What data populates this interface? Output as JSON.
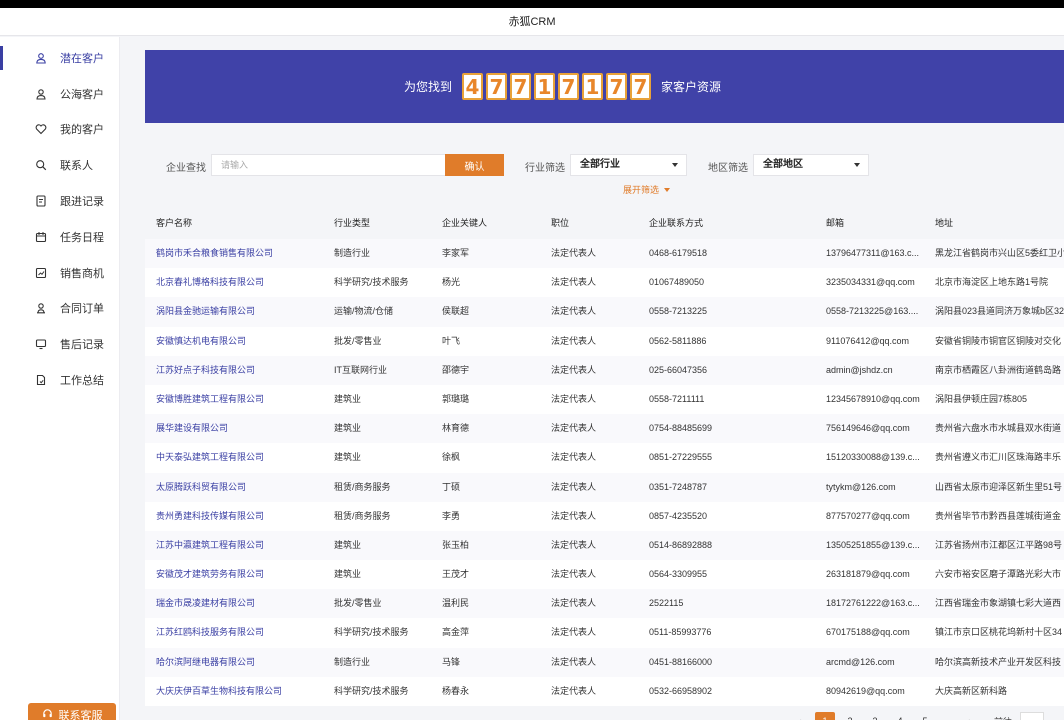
{
  "window": {
    "title": "赤狐CRM"
  },
  "sidebar": {
    "items": [
      {
        "label": "潜在客户",
        "icon": "user-icon"
      },
      {
        "label": "公海客户",
        "icon": "users-icon"
      },
      {
        "label": "我的客户",
        "icon": "heart-icon"
      },
      {
        "label": "联系人",
        "icon": "search-user-icon"
      },
      {
        "label": "跟进记录",
        "icon": "document-icon"
      },
      {
        "label": "任务日程",
        "icon": "calendar-icon"
      },
      {
        "label": "销售商机",
        "icon": "chart-icon"
      },
      {
        "label": "合同订单",
        "icon": "contract-icon"
      },
      {
        "label": "售后记录",
        "icon": "monitor-icon"
      },
      {
        "label": "工作总结",
        "icon": "summary-icon"
      }
    ],
    "service_label": "联系客服"
  },
  "banner": {
    "prefix": "为您找到",
    "digits": [
      "4",
      "7",
      "7",
      "1",
      "7",
      "1",
      "7",
      "7"
    ],
    "suffix": "家客户资源"
  },
  "filters": {
    "search_label": "企业查找",
    "search_placeholder": "请输入",
    "confirm_label": "确认",
    "industry_label": "行业筛选",
    "industry_value": "全部行业",
    "region_label": "地区筛选",
    "region_value": "全部地区",
    "expand_label": "展开筛选"
  },
  "table": {
    "columns": [
      "客户名称",
      "行业类型",
      "企业关键人",
      "职位",
      "企业联系方式",
      "邮箱",
      "地址"
    ],
    "rows": [
      [
        "鹤岗市禾合粮食销售有限公司",
        "制造行业",
        "李家军",
        "法定代表人",
        "0468-6179518",
        "13796477311@163.c...",
        "黑龙江省鹤岗市兴山区5委红卫小"
      ],
      [
        "北京春礼博格科技有限公司",
        "科学研究/技术服务",
        "杨光",
        "法定代表人",
        "01067489050",
        "3235034331@qq.com",
        "北京市海淀区上地东路1号院"
      ],
      [
        "涡阳县金驰运输有限公司",
        "运输/物流/仓储",
        "侯联超",
        "法定代表人",
        "0558-7213225",
        "0558-7213225@163....",
        "涡阳县023县道同济万象城b区32"
      ],
      [
        "安徽慎达机电有限公司",
        "批发/零售业",
        "叶飞",
        "法定代表人",
        "0562-5811886",
        "911076412@qq.com",
        "安徽省铜陵市铜官区铜陵对交化"
      ],
      [
        "江苏好点子科技有限公司",
        "IT互联网行业",
        "邵德宇",
        "法定代表人",
        "025-66047356",
        "admin@jshdz.cn",
        "南京市栖霞区八卦洲街道鹤岛路"
      ],
      [
        "安徽博胜建筑工程有限公司",
        "建筑业",
        "郭璐璐",
        "法定代表人",
        "0558-7211111",
        "12345678910@qq.com",
        "涡阳县伊顿庄园7栋805"
      ],
      [
        "展华建设有限公司",
        "建筑业",
        "林育德",
        "法定代表人",
        "0754-88485699",
        "756149646@qq.com",
        "贵州省六盘水市水城县双水街道"
      ],
      [
        "中天泰弘建筑工程有限公司",
        "建筑业",
        "徐枫",
        "法定代表人",
        "0851-27229555",
        "15120330088@139.c...",
        "贵州省遵义市汇川区珠海路丰乐"
      ],
      [
        "太原腾跃科贸有限公司",
        "租赁/商务服务",
        "丁硕",
        "法定代表人",
        "0351-7248787",
        "tytykm@126.com",
        "山西省太原市迎泽区新生里51号"
      ],
      [
        "贵州勇建科技传媒有限公司",
        "租赁/商务服务",
        "李勇",
        "法定代表人",
        "0857-4235520",
        "877570277@qq.com",
        "贵州省毕节市黔西县莲城街道金"
      ],
      [
        "江苏中瀛建筑工程有限公司",
        "建筑业",
        "张玉柏",
        "法定代表人",
        "0514-86892888",
        "13505251855@139.c...",
        "江苏省扬州市江都区江平路98号"
      ],
      [
        "安徽茂才建筑劳务有限公司",
        "建筑业",
        "王茂才",
        "法定代表人",
        "0564-3309955",
        "263181879@qq.com",
        "六安市裕安区磨子潭路光彩大市"
      ],
      [
        "瑞金市晟凌建材有限公司",
        "批发/零售业",
        "温利民",
        "法定代表人",
        "2522115",
        "18172761222@163.c...",
        "江西省瑞金市象湖镇七彩大道西"
      ],
      [
        "江苏红鸥科技服务有限公司",
        "科学研究/技术服务",
        "高金萍",
        "法定代表人",
        "0511-85993776",
        "670175188@qq.com",
        "镇江市京口区桃花坞新村十区34"
      ],
      [
        "哈尔滨阿继电器有限公司",
        "制造行业",
        "马锋",
        "法定代表人",
        "0451-88166000",
        "arcmd@126.com",
        "哈尔滨高新技术产业开发区科技"
      ],
      [
        "大庆庆伊百草生物科技有限公司",
        "科学研究/技术服务",
        "杨春永",
        "法定代表人",
        "0532-66958902",
        "80942619@qq.com",
        "大庆高新区新科路"
      ]
    ]
  },
  "pagination": {
    "prev": "‹",
    "pages": [
      "1",
      "2",
      "3",
      "4",
      "5",
      "···"
    ],
    "next": "›",
    "goto_label": "前往"
  },
  "colors": {
    "brand": "#4042a8",
    "accent": "#e07c2a",
    "link": "#3a3fa3"
  }
}
